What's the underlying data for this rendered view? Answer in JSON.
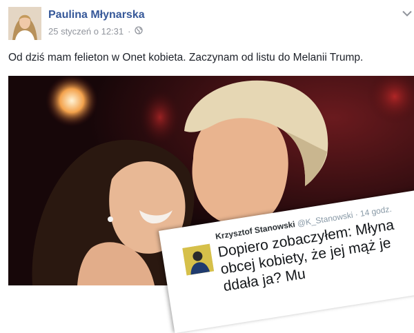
{
  "post": {
    "author": "Paulina Młynarska",
    "date": "25 styczeń o 12:31",
    "separator": "·",
    "text": "Od dziś mam felieton w Onet kobieta. Zaczynam od listu do Melanii Trump."
  },
  "tweet": {
    "name": "Krzysztof Stanowski",
    "handle": "@K_Stanowski",
    "separator": "·",
    "time": "14 godz.",
    "lines": [
      "Dopiero zobaczyłem: Młyna",
      "obcej kobiety, że jej mąż je",
      "ddała ja? Mu"
    ]
  },
  "icons": {
    "audience": "globe-icon",
    "menu": "chevron-down-icon",
    "author_avatar": "avatar",
    "tweet_avatar": "avatar"
  },
  "colors": {
    "author_link": "#365899",
    "meta": "#90949c",
    "text": "#1d2129"
  }
}
